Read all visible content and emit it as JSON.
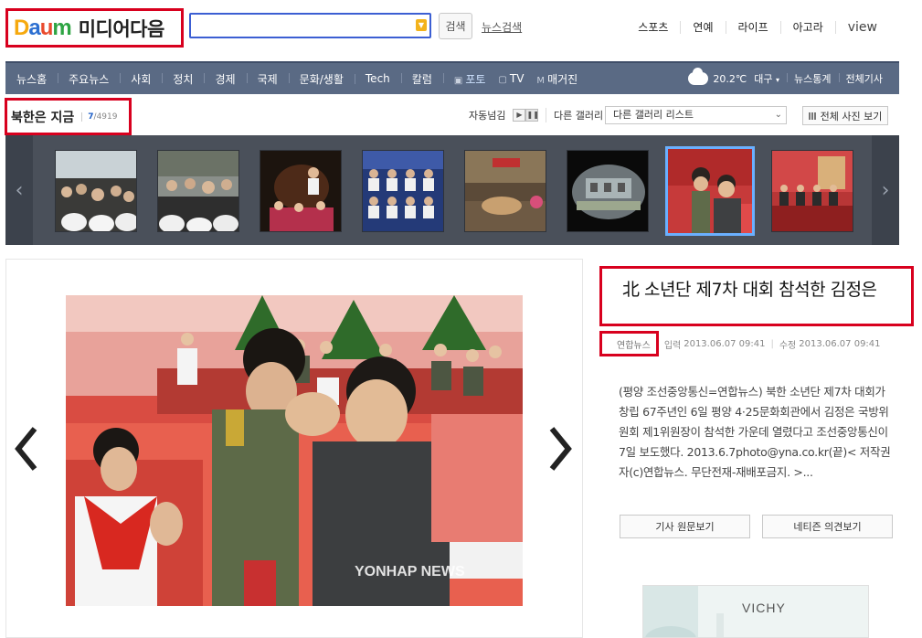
{
  "header": {
    "brand": "미디어다음",
    "search_button": "검색",
    "news_search": "뉴스검색",
    "top_nav": [
      "스포츠",
      "연예",
      "라이프",
      "아고라",
      "view"
    ]
  },
  "nav": {
    "items": [
      "뉴스홈",
      "주요뉴스",
      "사회",
      "정치",
      "경제",
      "국제",
      "문화/생활",
      "Tech",
      "칼럼"
    ],
    "media": [
      {
        "icon": "photo-icon",
        "label": "포토"
      },
      {
        "icon": "tv-icon",
        "label": "TV"
      },
      {
        "icon": "magazine-icon",
        "label": "매거진"
      }
    ],
    "weather_temp": "20.2℃",
    "weather_city": "대구",
    "right_links": [
      "뉴스통계",
      "전체기사"
    ]
  },
  "gallery": {
    "title": "북한은 지금",
    "current": "7",
    "total": "/4919",
    "auto_play": "자동넘김",
    "other_gallery": "다른 갤러리",
    "select_value": "다른 갤러리 리스트",
    "view_all": "전체 사진 보기"
  },
  "article": {
    "headline": "北 소년단 제7차 대회 참석한 김정은",
    "source": "연합뉴스",
    "input_label": "입력",
    "input_time": "2013.06.07 09:41",
    "edit_label": "수정",
    "edit_time": "2013.06.07 09:41",
    "summary": "(평양 조선중앙통신=연합뉴스) 북한 소년단 제7차 대회가 창립 67주년인 6일 평양 4·25문화회관에서 김정은 국방위원회 제1위원장이 참석한 가운데 열렸다고 조선중앙통신이 7일 보도했다. 2013.6.7photo@yna.co.kr(끝)< 저작권자(c)연합뉴스. 무단전재-재배포금지. >...",
    "original_button": "기사 원문보기",
    "opinion_button": "네티즌 의견보기"
  },
  "photo": {
    "watermark": "YONHAP NEWS"
  },
  "ad": {
    "brand": "VICHY"
  },
  "colors": {
    "highlight_border": "#d8001e",
    "nav_bg": "#5a6a84",
    "strip_bg": "#4a505a",
    "active_thumb": "#6ab0ff"
  }
}
